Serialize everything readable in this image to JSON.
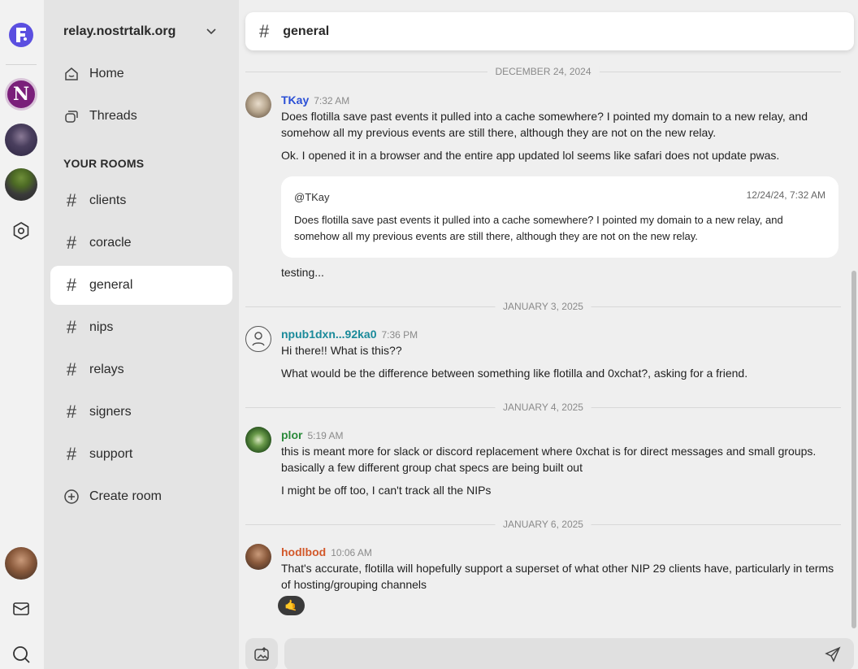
{
  "relay": {
    "name": "relay.nostrtalk.org"
  },
  "nav": {
    "home": "Home",
    "threads": "Threads"
  },
  "rooms": {
    "heading": "YOUR ROOMS",
    "items": [
      "clients",
      "coracle",
      "general",
      "nips",
      "relays",
      "signers",
      "support"
    ],
    "create": "Create room",
    "active": "general"
  },
  "rail": {
    "server_initial": "N"
  },
  "channel": {
    "title": "general"
  },
  "dates": {
    "d1": "DECEMBER 24, 2024",
    "d2": "JANUARY 3, 2025",
    "d3": "JANUARY 4, 2025",
    "d4": "JANUARY 6, 2025"
  },
  "messages": {
    "m1": {
      "author": "TKay",
      "time": "7:32 AM",
      "color": "#2a4fd6",
      "text1": "Does flotilla save past events it pulled into a cache somewhere? I pointed my domain to a new relay, and somehow all my previous events are still there, although they are not on the new relay.",
      "text2": "Ok. I opened it in a browser and the entire app updated lol seems like safari does not update pwas.",
      "quote_author": "@TKay",
      "quote_time": "12/24/24, 7:32 AM",
      "quote_text": "Does flotilla save past events it pulled into a cache somewhere? I pointed my domain to a new relay, and somehow all my previous events are still there, although they are not on the new relay.",
      "text3": "testing..."
    },
    "m2": {
      "author": "npub1dxn...92ka0",
      "time": "7:36 PM",
      "color": "#1a8a9a",
      "text1": "Hi there!! What is this??",
      "text2": "What would be the difference between something like flotilla and 0xchat?, asking for a friend."
    },
    "m3": {
      "author": "plor",
      "time": "5:19 AM",
      "color": "#2a8a3a",
      "text1": "this is meant more for slack or discord replacement where 0xchat is for direct messages and small groups. basically a few different group chat specs are being built out",
      "text2": "I might be off too, I can't track all the NIPs"
    },
    "m4": {
      "author": "hodlbod",
      "time": "10:06 AM",
      "color": "#d2582a",
      "text1": "That's accurate, flotilla will hopefully support a superset of what other NIP 29 clients have, particularly in terms of hosting/grouping channels",
      "reaction": "🤙"
    }
  },
  "icons": {
    "logo": "flotilla-logo-icon",
    "settings": "settings-icon",
    "mail": "mail-icon",
    "search": "search-icon",
    "home": "home-icon",
    "threads": "threads-icon",
    "hash": "hash-icon",
    "plus": "plus-circle-icon",
    "send": "send-icon",
    "image": "image-upload-icon",
    "chevron": "chevron-down-icon"
  }
}
